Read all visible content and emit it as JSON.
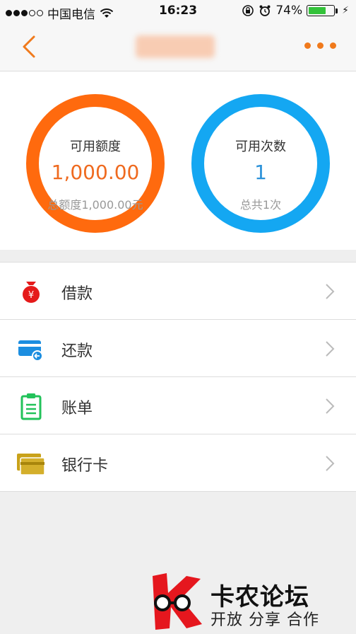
{
  "status": {
    "carrier": "中国电信",
    "time": "16:23",
    "battery": "74%",
    "battery_level": 0.74
  },
  "stats": {
    "limit": {
      "title": "可用额度",
      "value": "1,000.00",
      "sub": "总额度1,000.00元"
    },
    "count": {
      "title": "可用次数",
      "value": "1",
      "sub": "总共1次"
    }
  },
  "menu": [
    {
      "label": "借款",
      "icon": "money-bag-icon"
    },
    {
      "label": "还款",
      "icon": "card-repay-icon"
    },
    {
      "label": "账单",
      "icon": "clipboard-icon"
    },
    {
      "label": "银行卡",
      "icon": "bank-card-icon"
    }
  ],
  "watermark": {
    "title": "卡农论坛",
    "slogan": "开放 分享 合作"
  },
  "colors": {
    "orange": "#ff6a0e",
    "blue": "#14a7f2",
    "green": "#33c23a"
  }
}
